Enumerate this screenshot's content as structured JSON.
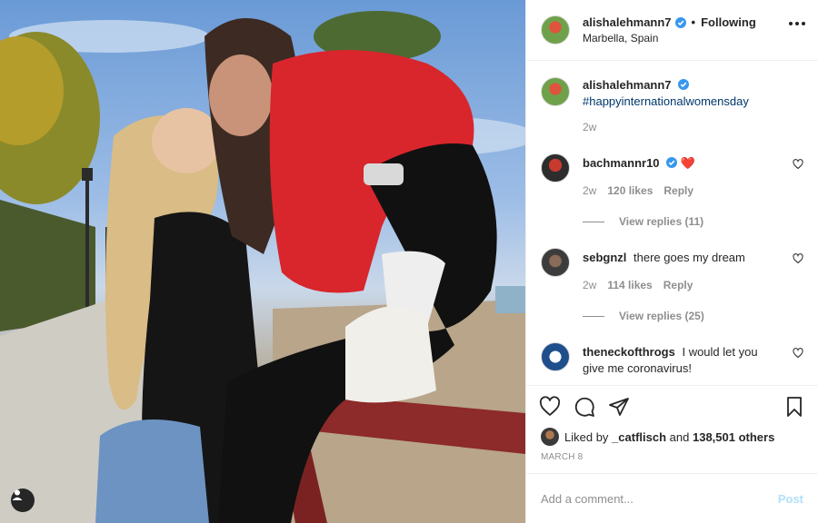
{
  "post": {
    "author": "alishalehmann7",
    "follow_status": "Following",
    "separator": "•",
    "location": "Marbella, Spain",
    "caption": "#happyinternationalwomensday",
    "caption_time": "2w"
  },
  "comments": [
    {
      "user": "bachmannr10",
      "verified": true,
      "text": "❤️",
      "time": "2w",
      "likes": "120 likes",
      "reply_label": "Reply",
      "replies": "View replies (11)"
    },
    {
      "user": "sebgnzl",
      "verified": false,
      "text": "there goes my dream",
      "time": "2w",
      "likes": "114 likes",
      "reply_label": "Reply",
      "replies": "View replies (25)"
    },
    {
      "user": "theneckofthrogs",
      "verified": false,
      "text": "I would let you give me coronavirus!"
    }
  ],
  "likes": {
    "prefix": "Liked by",
    "first_user": "_catflisch",
    "conjunction": "and",
    "others": "138,501 others"
  },
  "date": "MARCH 8",
  "add_comment": {
    "placeholder": "Add a comment...",
    "post_label": "Post"
  },
  "colors": {
    "verified": "#3897f0",
    "heart": "#ed4956",
    "post_disabled": "#b2dffc",
    "hashtag": "#00376b"
  }
}
